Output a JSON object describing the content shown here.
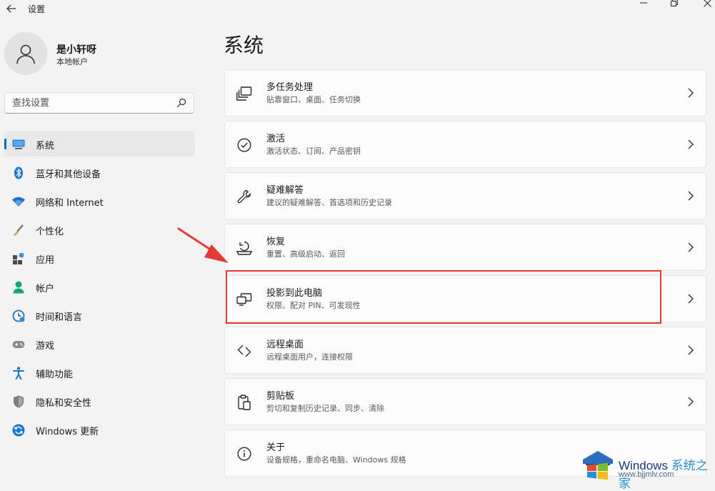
{
  "window": {
    "title": "设置",
    "back_icon": "arrow-left-icon",
    "controls": [
      "minimize-icon",
      "maximize-icon",
      "close-icon"
    ]
  },
  "user": {
    "name": "是小轩呀",
    "account_type": "本地帐户",
    "avatar_icon": "person-icon"
  },
  "search": {
    "placeholder": "查找设置",
    "icon": "search-icon"
  },
  "sidebar": {
    "accent_color": "#0067c0",
    "items": [
      {
        "label": "系统",
        "icon": "monitor-icon",
        "selected": true
      },
      {
        "label": "蓝牙和其他设备",
        "icon": "bluetooth-icon"
      },
      {
        "label": "网络和 Internet",
        "icon": "wifi-icon"
      },
      {
        "label": "个性化",
        "icon": "brush-icon"
      },
      {
        "label": "应用",
        "icon": "apps-icon"
      },
      {
        "label": "帐户",
        "icon": "account-icon"
      },
      {
        "label": "时间和语言",
        "icon": "clock-globe-icon"
      },
      {
        "label": "游戏",
        "icon": "gamepad-icon"
      },
      {
        "label": "辅助功能",
        "icon": "accessibility-icon"
      },
      {
        "label": "隐私和安全性",
        "icon": "shield-icon"
      },
      {
        "label": "Windows 更新",
        "icon": "update-icon"
      }
    ]
  },
  "main": {
    "title": "系统",
    "cards": [
      {
        "title": "多任务处理",
        "subtitle": "贴靠窗口、桌面、任务切换",
        "icon": "multitasking-icon"
      },
      {
        "title": "激活",
        "subtitle": "激活状态、订阅、产品密钥",
        "icon": "check-circle-icon"
      },
      {
        "title": "疑难解答",
        "subtitle": "建议的疑难解答、首选项和历史记录",
        "icon": "wrench-icon"
      },
      {
        "title": "恢复",
        "subtitle": "重置、高级启动、返回",
        "icon": "recovery-icon"
      },
      {
        "title": "投影到此电脑",
        "subtitle": "权限、配对 PIN、可发现性",
        "icon": "projection-icon",
        "highlighted": true
      },
      {
        "title": "远程桌面",
        "subtitle": "远程桌面用户，连接权限",
        "icon": "remote-desktop-icon"
      },
      {
        "title": "剪贴板",
        "subtitle": "剪切和复制历史记录、同步、清除",
        "icon": "clipboard-icon"
      },
      {
        "title": "关于",
        "subtitle": "设备规格，重命名电脑、Windows 规格",
        "icon": "info-icon"
      }
    ]
  },
  "annotation": {
    "color": "#e53935"
  },
  "watermark": {
    "brand": "Windows",
    "brand_suffix": "系统之家",
    "url": "www.bjjmlv.com"
  }
}
